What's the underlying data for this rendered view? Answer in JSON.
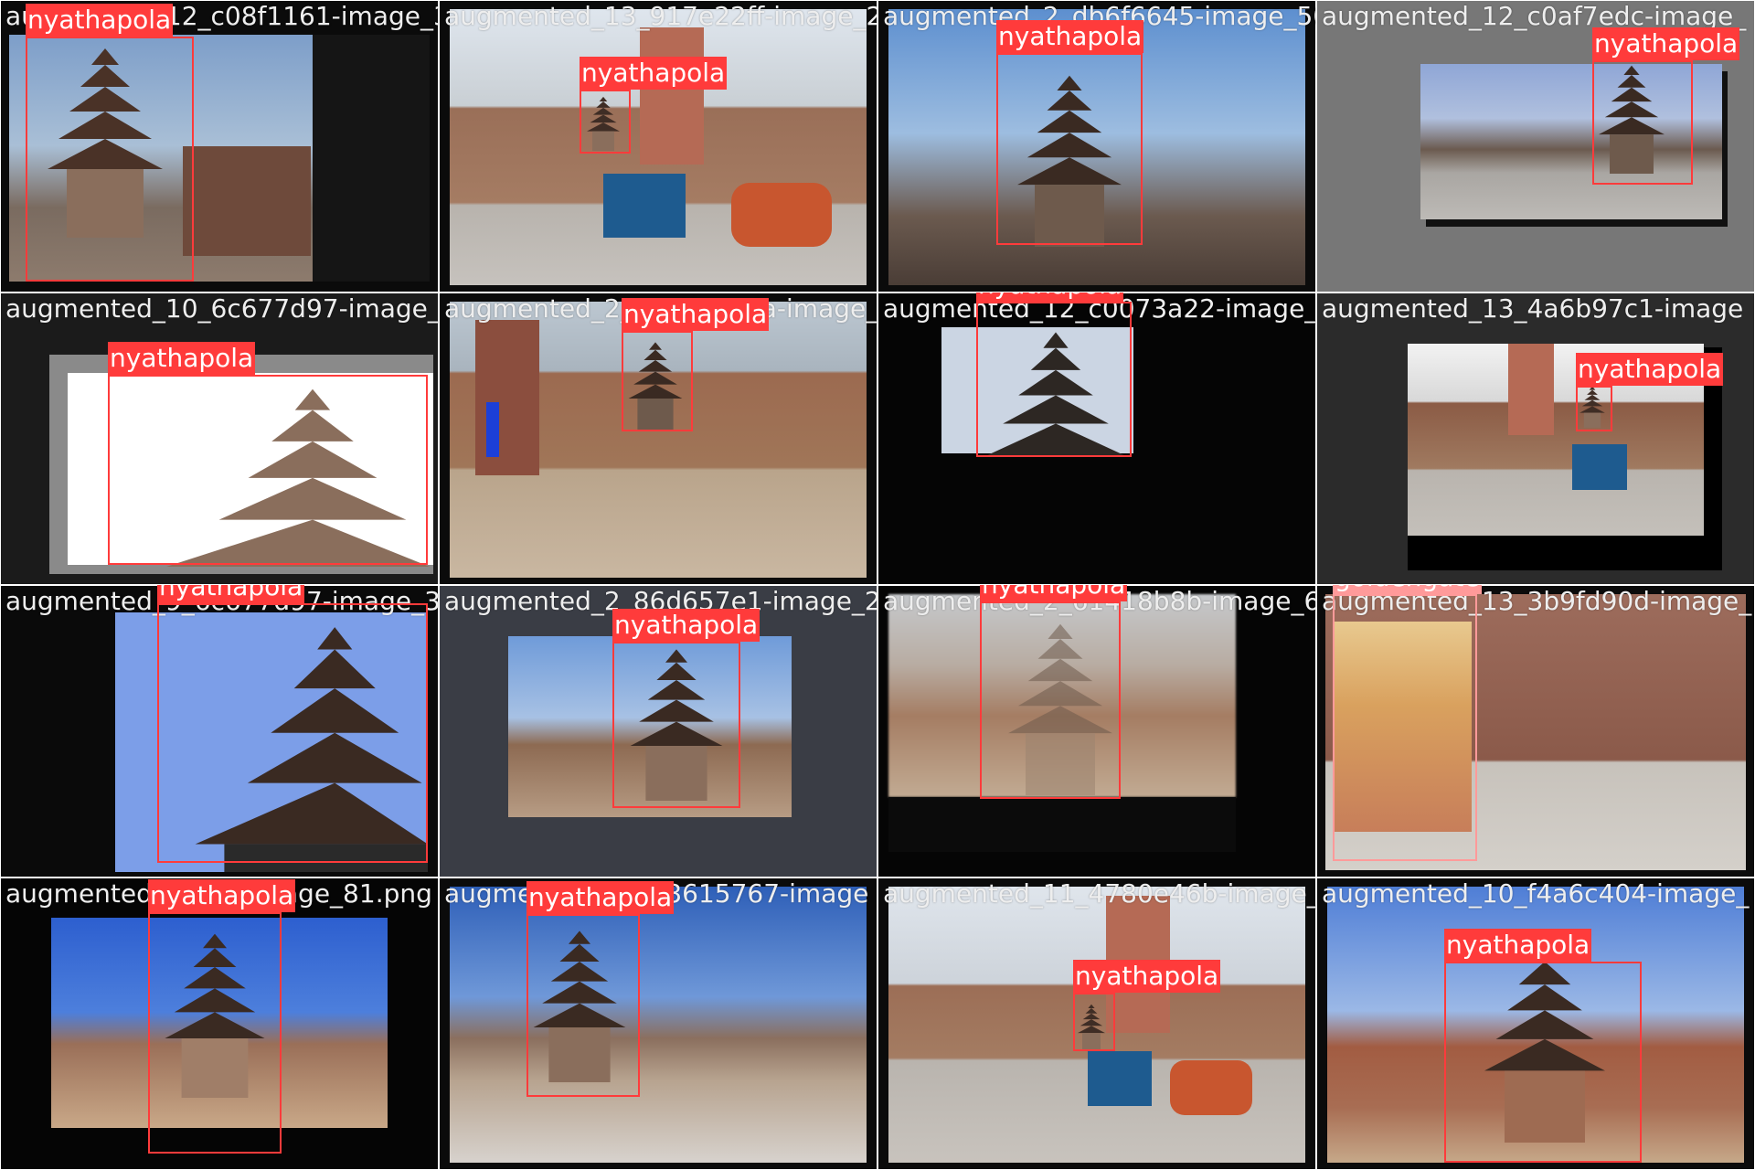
{
  "tiles": [
    {
      "file": "augmented_12_c08f1161-image_30.png",
      "label": "nyathapola"
    },
    {
      "file": "augmented_13_917e22ff-image_202.png",
      "label": "nyathapola"
    },
    {
      "file": "augmented_2_db6f6645-image_503.png",
      "label": "nyathapola"
    },
    {
      "file": "augmented_12_c0af7edc-image_",
      "label": "nyathapola"
    },
    {
      "file": "augmented_10_6c677d97-image_32.png",
      "label": "nyathapola"
    },
    {
      "file": "augmented_2_nyathapola-image_211.png",
      "label": "nyathapola"
    },
    {
      "file": "augmented_12_c0073a22-image_229.png",
      "label": "nyathapola"
    },
    {
      "file": "augmented_13_4a6b97c1-image",
      "label": "nyathapola"
    },
    {
      "file": "augmented_9_6c677d97-image_32.png",
      "label": "nyathapola"
    },
    {
      "file": "augmented_2_86d657e1-image_248.png",
      "label": "nyathapola"
    },
    {
      "file": "augmented_2_61418b8b-image_63.png",
      "label": "nyathapola"
    },
    {
      "file": "augmented_13_3b9fd90d-image_",
      "label": "goldengate"
    },
    {
      "file": "augmented_11_c1-image_81.png",
      "label": "nyathapola"
    },
    {
      "file": "augmented_11_93615767-image",
      "label": "nyathapola"
    },
    {
      "file": "augmented_11_4780e46b-image_155.png",
      "label": "nyathapola"
    },
    {
      "file": "augmented_10_f4a6c404-image_",
      "label": "nyathapola"
    }
  ],
  "colors": {
    "box_nyathapola": "#ff3b3b",
    "box_goldengate": "#ff9a9a",
    "filename_text": "#eeeeee"
  }
}
